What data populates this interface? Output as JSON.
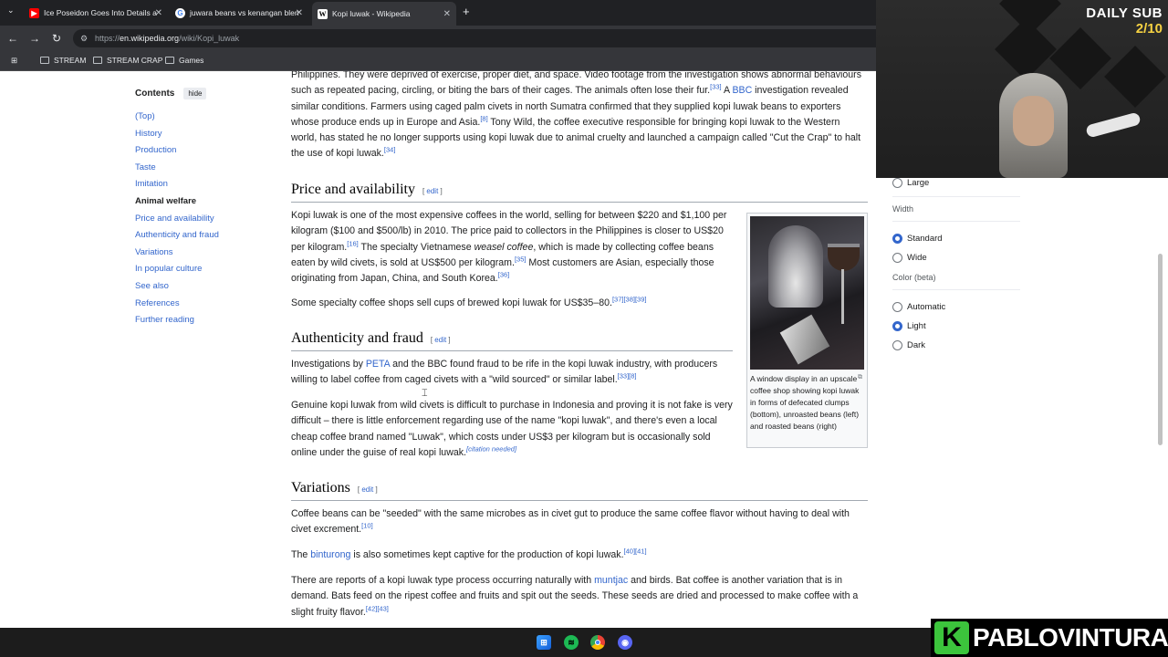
{
  "browser": {
    "tabs": [
      {
        "title": "Ice Poseidon Goes Into Details a",
        "icon": "youtube-icon",
        "color": "#ff0000"
      },
      {
        "title": "juwara beans vs kenangan blen",
        "icon": "google-icon",
        "color": "#4285f4"
      },
      {
        "title": "Kopi luwak - Wikipedia",
        "icon": "wikipedia-icon",
        "color": "#ffffff"
      }
    ],
    "url_prefix": "https://",
    "url_host": "en.wikipedia.org",
    "url_path": "/wiki/Kopi_luwak",
    "bookmarks": [
      "STREAM",
      "STREAM CRAP",
      "Games"
    ]
  },
  "toc": {
    "title": "Contents",
    "hide_label": "hide",
    "items": [
      "(Top)",
      "History",
      "Production",
      "Taste",
      "Imitation",
      "Animal welfare",
      "Price and availability",
      "Authenticity and fraud",
      "Variations",
      "In popular culture",
      "See also",
      "References",
      "Further reading"
    ]
  },
  "article": {
    "p0": {
      "t1": "Philippines. They were deprived of exercise, proper diet, and space. Video footage from the investigation shows abnormal behaviours such as repeated pacing, circling, or biting the bars of their cages. The animals often lose their fur.",
      "r1": "[33]",
      "t2": " A ",
      "l1": "BBC",
      "t3": " investigation revealed similar conditions. Farmers using caged palm civets in north Sumatra confirmed that they supplied kopi luwak beans to exporters whose produce ends up in Europe and Asia.",
      "r2": "[8]",
      "t4": " Tony Wild, the coffee executive responsible for bringing kopi luwak to the Western world, has stated he no longer supports using kopi luwak due to animal cruelty and launched a campaign called \"Cut the Crap\" to halt the use of kopi luwak.",
      "r3": "[34]"
    },
    "price": {
      "heading": "Price and availability",
      "p1": {
        "t1": "Kopi luwak is one of the most expensive coffees in the world, selling for between $220 and $1,100 per kilogram ($100 and $500/lb) in 2010. The price paid to collectors in the Philippines is closer to US$20 per kilogram.",
        "r1": "[16]",
        "t2": " The specialty Vietnamese ",
        "em": "weasel coffee",
        "t3": ", which is made by collecting coffee beans eaten by wild civets, is sold at US$500 per kilogram.",
        "r2": "[35]",
        "t4": " Most customers are Asian, especially those originating from Japan, China, and South Korea.",
        "r3": "[36]"
      },
      "p2": {
        "t1": "Some specialty coffee shops sell cups of brewed kopi luwak for US$35–80.",
        "r1": "[37][38][39]"
      }
    },
    "auth": {
      "heading": "Authenticity and fraud",
      "p1": {
        "t1": "Investigations by ",
        "l1": "PETA",
        "t2": " and the BBC found fraud to be rife in the kopi luwak industry, with producers willing to label coffee from caged civets with a \"wild sourced\" or similar label.",
        "r1": "[33][8]"
      },
      "p2": {
        "t1": "Genuine kopi luwak from wild civets is difficult to purchase in Indonesia and proving it is not fake is very difficult – there is little enforcement regarding use of the name \"kopi luwak\", and there's even a local cheap coffee brand named \"Luwak\", which costs under US$3 per kilogram but is occasionally sold online under the guise of real kopi luwak.",
        "cn": "[citation needed]"
      }
    },
    "variations": {
      "heading": "Variations",
      "p1": {
        "t1": "Coffee beans can be \"seeded\" with the same microbes as in civet gut to produce the same coffee flavor without having to deal with civet excrement.",
        "r1": "[10]"
      },
      "p2": {
        "t1": "The ",
        "l1": "binturong",
        "t2": " is also sometimes kept captive for the production of kopi luwak.",
        "r1": "[40][41]"
      },
      "p3": {
        "t1": "There are reports of a kopi luwak type process occurring naturally with ",
        "l1": "muntjac",
        "t2": " and birds. Bat coffee is another variation that is in demand. Bats feed on the ripest coffee and fruits and spit out the seeds. These seeds are dried and processed to make coffee with a slight fruity flavor.",
        "r1": "[42][43]"
      }
    },
    "edit_label": "edit",
    "caption": "A window display in an upscale coffee shop showing kopi luwak in forms of defecated clumps (bottom), unroasted beans (left) and roasted beans (right)"
  },
  "appearance": {
    "size_option": "Large",
    "width_label": "Width",
    "width_options": [
      "Standard",
      "Wide"
    ],
    "width_selected": "Standard",
    "color_label": "Color (beta)",
    "color_options": [
      "Automatic",
      "Light",
      "Dark"
    ],
    "color_selected": "Light"
  },
  "overlay": {
    "sub_label": "DAILY SUB",
    "sub_count": "2/10",
    "brand_letter": "K",
    "brand_name": "PABLOVINTURA"
  },
  "colors": {
    "link": "#3366cc",
    "accent_green": "#3cc43c",
    "sub_yellow": "#f5d142"
  }
}
